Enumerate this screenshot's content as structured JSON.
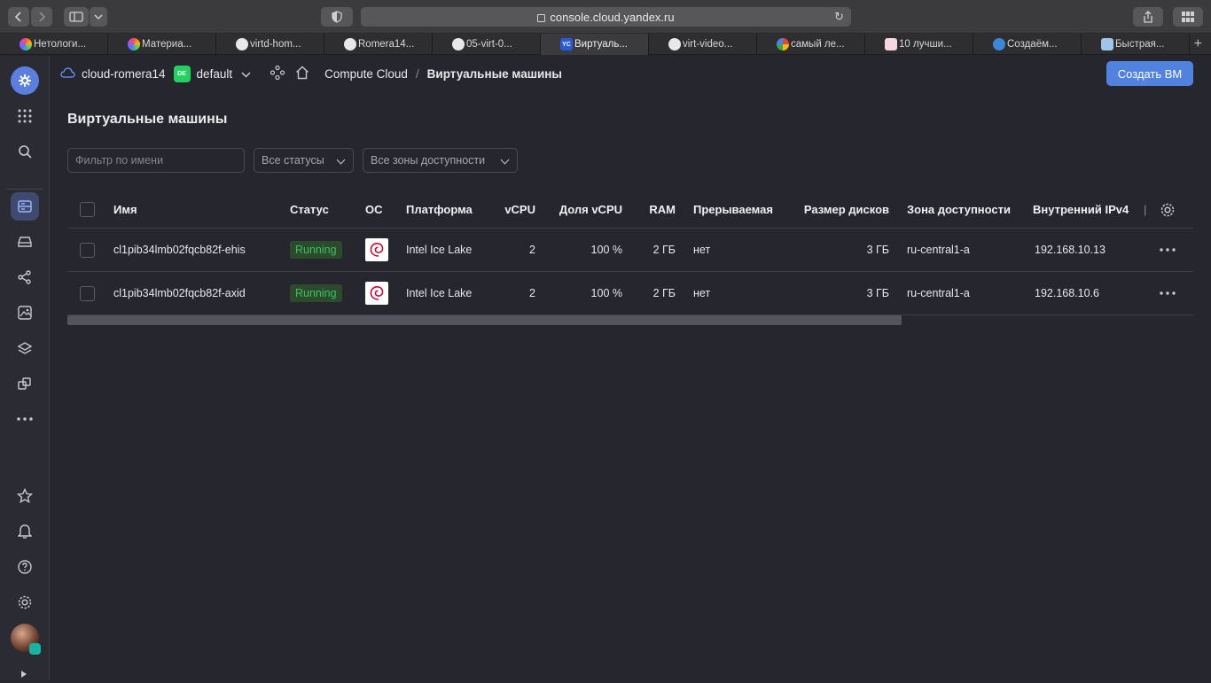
{
  "browser": {
    "url": "console.cloud.yandex.ru",
    "tabs": [
      {
        "label": "Нетологи...",
        "color": "#b04cff"
      },
      {
        "label": "Материа...",
        "color": "#b04cff"
      },
      {
        "label": "virtd-hom...",
        "color": "#e8e8e8"
      },
      {
        "label": "Romera14...",
        "color": "#e8e8e8"
      },
      {
        "label": "05-virt-0...",
        "color": "#e8e8e8"
      },
      {
        "label": "Виртуаль...",
        "color": "#2a5bd7"
      },
      {
        "label": "virt-video...",
        "color": "#e8e8e8"
      },
      {
        "label": "самый ле...",
        "color": "#ffffff"
      },
      {
        "label": "10 лучши...",
        "color": "#e96a8f"
      },
      {
        "label": "Создаём...",
        "color": "#3b86d6"
      },
      {
        "label": "Быстрая...",
        "color": "#9fc5e8"
      }
    ]
  },
  "header": {
    "cloud_name": "cloud-romera14",
    "workspace_badge": "DE",
    "workspace": "default",
    "service": "Compute Cloud",
    "section": "Виртуальные машины",
    "create_button": "Создать ВМ"
  },
  "page": {
    "title": "Виртуальные машины",
    "filter_placeholder": "Фильтр по имени",
    "status_select": "Все статусы",
    "zone_select": "Все зоны доступности"
  },
  "table": {
    "columns": {
      "name": "Имя",
      "status": "Статус",
      "os": "ОС",
      "platform": "Платформа",
      "vcpu": "vCPU",
      "vcpu_share": "Доля vCPU",
      "ram": "RAM",
      "preemptible": "Прерываемая",
      "disk_size": "Размер дисков",
      "zone": "Зона доступности",
      "ipv4": "Внутренний IPv4"
    },
    "rows": [
      {
        "name": "cl1pib34lmb02fqcb82f-ehis",
        "status": "Running",
        "os": "debian-icon",
        "platform": "Intel Ice Lake",
        "vcpu": "2",
        "vcpu_share": "100 %",
        "ram": "2 ГБ",
        "preemptible": "нет",
        "disk_size": "3 ГБ",
        "zone": "ru-central1-a",
        "ipv4": "192.168.10.13"
      },
      {
        "name": "cl1pib34lmb02fqcb82f-axid",
        "status": "Running",
        "os": "debian-icon",
        "platform": "Intel Ice Lake",
        "vcpu": "2",
        "vcpu_share": "100 %",
        "ram": "2 ГБ",
        "preemptible": "нет",
        "disk_size": "3 ГБ",
        "zone": "ru-central1-a",
        "ipv4": "192.168.10.6"
      }
    ]
  },
  "colors": {
    "accent": "#5282e0",
    "running": "#36c45e",
    "background": "#26262e"
  }
}
